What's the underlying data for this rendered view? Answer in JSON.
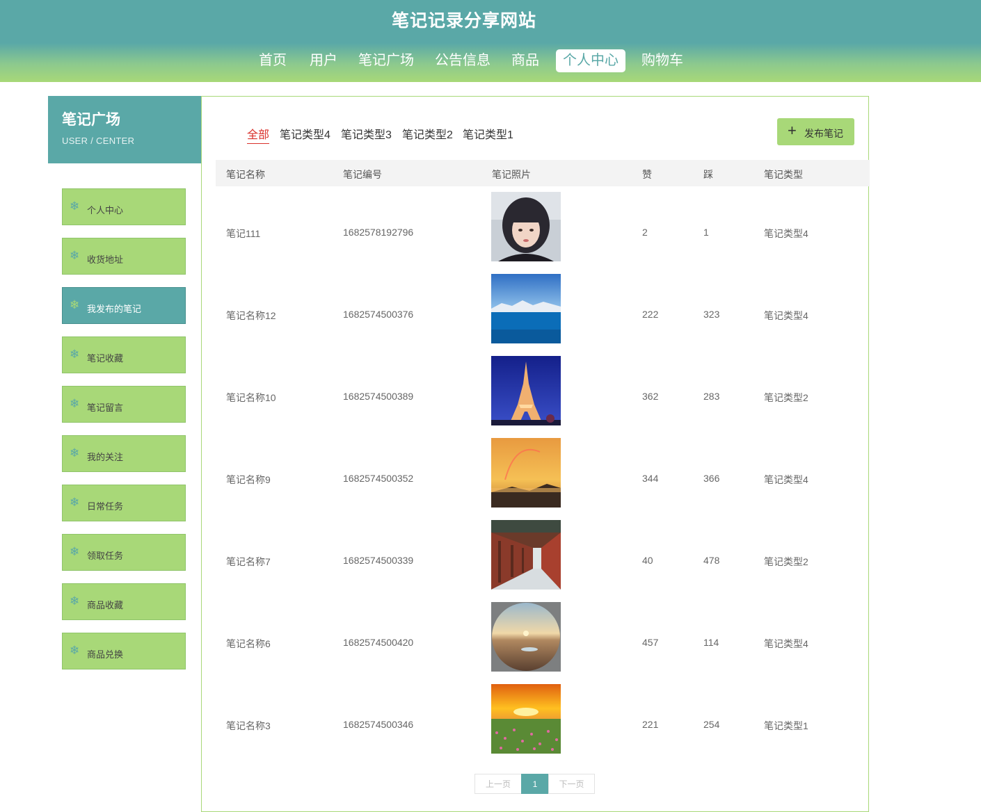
{
  "site": {
    "title": "笔记记录分享网站"
  },
  "nav": [
    {
      "label": "首页"
    },
    {
      "label": "用户"
    },
    {
      "label": "笔记广场"
    },
    {
      "label": "公告信息"
    },
    {
      "label": "商品"
    },
    {
      "label": "个人中心",
      "active": true
    },
    {
      "label": "购物车"
    }
  ],
  "sidebar": {
    "title": "笔记广场",
    "subtitle": "USER / CENTER",
    "icon": "snowflake-icon",
    "items": [
      {
        "label": "个人中心"
      },
      {
        "label": "收货地址"
      },
      {
        "label": "我发布的笔记",
        "active": true
      },
      {
        "label": "笔记收藏"
      },
      {
        "label": "笔记留言"
      },
      {
        "label": "我的关注"
      },
      {
        "label": "日常任务"
      },
      {
        "label": "领取任务"
      },
      {
        "label": "商品收藏"
      },
      {
        "label": "商品兑换"
      }
    ]
  },
  "filters": [
    {
      "label": "全部",
      "active": true
    },
    {
      "label": "笔记类型4"
    },
    {
      "label": "笔记类型3"
    },
    {
      "label": "笔记类型2"
    },
    {
      "label": "笔记类型1"
    }
  ],
  "publish_button": {
    "icon": "plus-icon",
    "label": "发布笔记"
  },
  "table": {
    "headers": [
      "笔记名称",
      "笔记编号",
      "笔记照片",
      "赞",
      "踩",
      "笔记类型"
    ],
    "rows": [
      {
        "name": "笔记111",
        "code": "1682578192796",
        "photo": "portrait",
        "likes": "2",
        "dislikes": "1",
        "type": "笔记类型4"
      },
      {
        "name": "笔记名称12",
        "code": "1682574500376",
        "photo": "sea-sky",
        "likes": "222",
        "dislikes": "323",
        "type": "笔记类型4"
      },
      {
        "name": "笔记名称10",
        "code": "1682574500389",
        "photo": "eiffel-tower",
        "likes": "362",
        "dislikes": "283",
        "type": "笔记类型2"
      },
      {
        "name": "笔记名称9",
        "code": "1682574500352",
        "photo": "rainbow-coast",
        "likes": "344",
        "dislikes": "366",
        "type": "笔记类型4"
      },
      {
        "name": "笔记名称7",
        "code": "1682574500339",
        "photo": "corridor",
        "likes": "40",
        "dislikes": "478",
        "type": "笔记类型2"
      },
      {
        "name": "笔记名称6",
        "code": "1682574500420",
        "photo": "desert-sunset",
        "likes": "457",
        "dislikes": "114",
        "type": "笔记类型4"
      },
      {
        "name": "笔记名称3",
        "code": "1682574500346",
        "photo": "flower-field",
        "likes": "221",
        "dislikes": "254",
        "type": "笔记类型1"
      }
    ]
  },
  "pagination": {
    "prev": "上一页",
    "current": "1",
    "next": "下一页"
  },
  "colors": {
    "teal": "#5aa8a7",
    "green": "#a8d878",
    "active_filter": "#d9302a"
  }
}
